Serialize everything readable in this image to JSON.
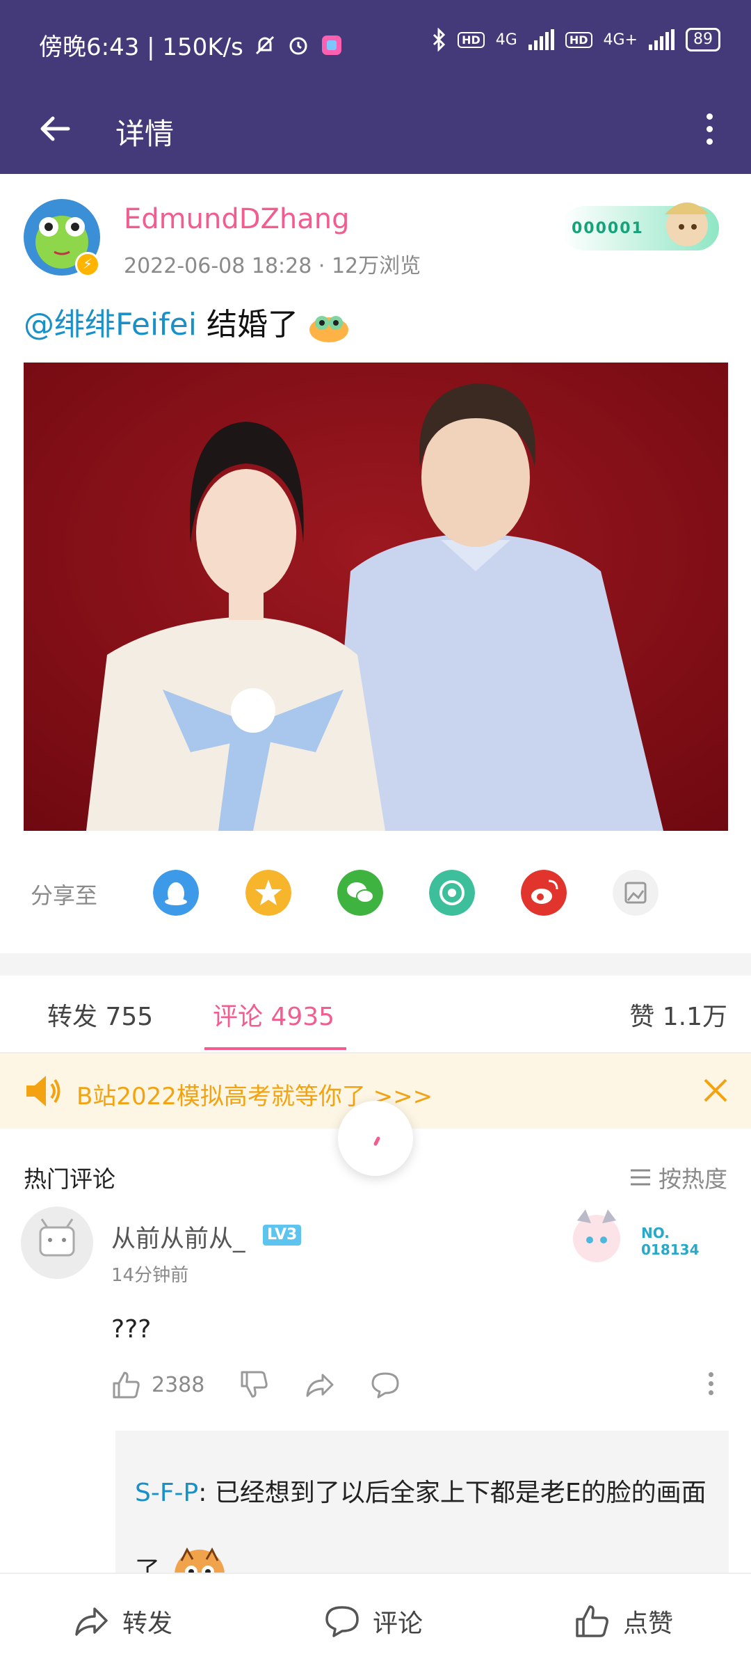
{
  "status_bar": {
    "time_speed": "傍晚6:43 | 150K/s",
    "network_hd_1": "HD",
    "network_4g_1": "4G",
    "network_hd_2": "HD",
    "network_4g_2": "4G+",
    "battery": "89"
  },
  "app_bar": {
    "title": "详情"
  },
  "post": {
    "author": "EdmundDZhang",
    "date": "2022-06-08 18:28",
    "views": "12万浏览",
    "fan_card_number": "000001",
    "mention": "@绯绯Feifei",
    "text": " 结婚了"
  },
  "share": {
    "label": "分享至",
    "targets": [
      "qq-icon",
      "qzone-icon",
      "wechat-icon",
      "moments-icon",
      "weibo-icon",
      "image-icon"
    ]
  },
  "tabs": {
    "repost": "转发 755",
    "comments": "评论 4935",
    "likes": "赞 1.1万"
  },
  "notice": {
    "text": "B站2022模拟高考就等你了 >>>"
  },
  "comments": {
    "section_title": "热门评论",
    "sort_label": "按热度",
    "items": [
      {
        "user": "从前从前从_",
        "level": "LV3",
        "time": "14分钟前",
        "card_no_label": "NO.",
        "card_no": "018134",
        "text": "???",
        "likes": "2388",
        "reply": {
          "user": "S-F-P",
          "text": ": 已经想到了以后全家上下都是老E的脸的画面了"
        }
      }
    ]
  },
  "bottom_bar": {
    "repost": "转发",
    "comment": "评论",
    "like": "点赞"
  },
  "colors": {
    "header_bg": "#443a79",
    "accent_pink": "#f25d8e",
    "link_blue": "#1a90c8",
    "notice_orange": "#f3a311"
  }
}
